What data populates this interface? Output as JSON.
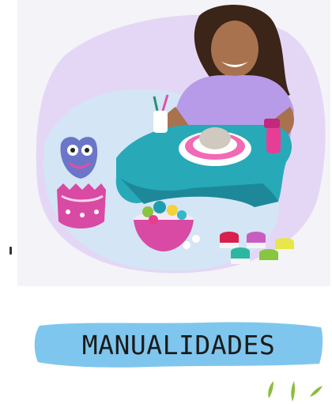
{
  "category_card": {
    "label": "MANUALIDADES",
    "image_description_icon": "pottery-wheel-craft-kit-photo",
    "colors": {
      "background": "#f4f3f7",
      "blob_purple": "#e4d7f6",
      "blob_teal": "#bfe9f3",
      "banner": "#7fc6ee",
      "sprouts": "#8dbd3a"
    }
  }
}
